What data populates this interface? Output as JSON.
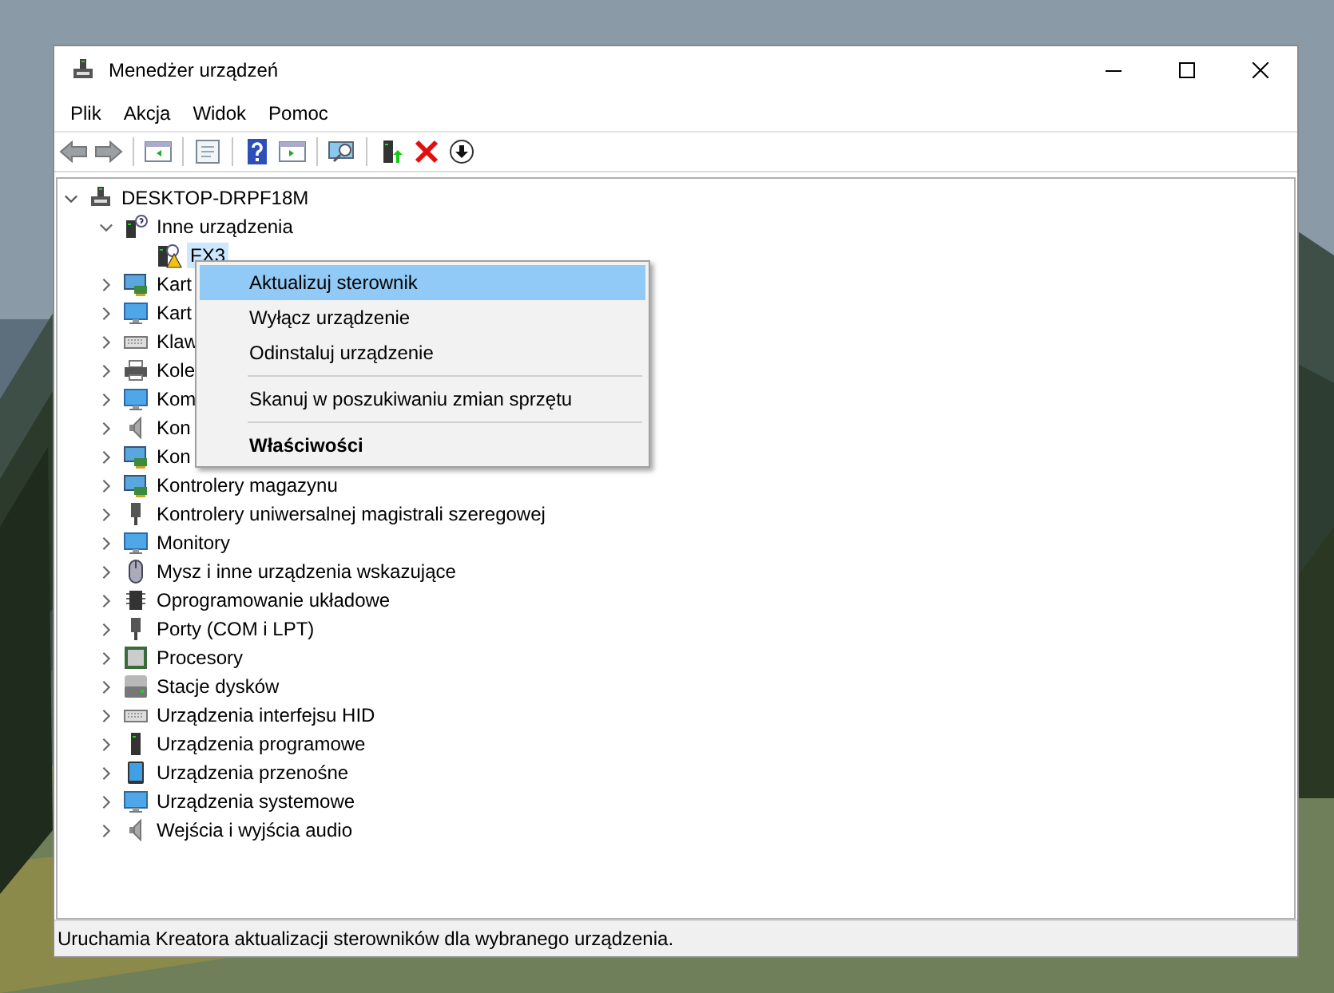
{
  "window": {
    "title": "Menedżer urządzeń"
  },
  "menu_bar": [
    "Plik",
    "Akcja",
    "Widok",
    "Pomoc"
  ],
  "tree": {
    "label": "DESKTOP-DRPF18M",
    "expanded": true,
    "selected": false,
    "children": [
      {
        "label": "Inne urządzenia",
        "expanded": true,
        "selected": false,
        "children": [
          {
            "label": "FX3",
            "selected": true,
            "warning": true
          }
        ]
      },
      {
        "label": "Kart",
        "expanded": false,
        "selected": false
      },
      {
        "label": "Kart",
        "expanded": false,
        "selected": false
      },
      {
        "label": "Klaw",
        "expanded": false,
        "selected": false
      },
      {
        "label": "Kole",
        "expanded": false,
        "selected": false
      },
      {
        "label": "Kom",
        "expanded": false,
        "selected": false
      },
      {
        "label": "Kon",
        "expanded": false,
        "selected": false
      },
      {
        "label": "Kon",
        "expanded": false,
        "selected": false
      },
      {
        "label": "Kontrolery magazynu",
        "expanded": false,
        "selected": false
      },
      {
        "label": "Kontrolery uniwersalnej magistrali szeregowej",
        "expanded": false,
        "selected": false
      },
      {
        "label": "Monitory",
        "expanded": false,
        "selected": false
      },
      {
        "label": "Mysz i inne urządzenia wskazujące",
        "expanded": false,
        "selected": false
      },
      {
        "label": "Oprogramowanie układowe",
        "expanded": false,
        "selected": false
      },
      {
        "label": "Porty (COM i LPT)",
        "expanded": false,
        "selected": false
      },
      {
        "label": "Procesory",
        "expanded": false,
        "selected": false
      },
      {
        "label": "Stacje dysków",
        "expanded": false,
        "selected": false
      },
      {
        "label": "Urządzenia interfejsu HID",
        "expanded": false,
        "selected": false
      },
      {
        "label": "Urządzenia programowe",
        "expanded": false,
        "selected": false
      },
      {
        "label": "Urządzenia przenośne",
        "expanded": false,
        "selected": false
      },
      {
        "label": "Urządzenia systemowe",
        "expanded": false,
        "selected": false
      },
      {
        "label": "Wejścia i wyjścia audio",
        "expanded": false,
        "selected": false
      }
    ]
  },
  "context_menu": [
    {
      "kind": "item",
      "label": "Aktualizuj sterownik",
      "selected": true,
      "default": false
    },
    {
      "kind": "item",
      "label": "Wyłącz urządzenie",
      "selected": false,
      "default": false
    },
    {
      "kind": "item",
      "label": "Odinstaluj urządzenie",
      "selected": false,
      "default": false
    },
    {
      "kind": "separator"
    },
    {
      "kind": "item",
      "label": "Skanuj w poszukiwaniu zmian sprzętu",
      "selected": false,
      "default": false
    },
    {
      "kind": "separator"
    },
    {
      "kind": "item",
      "label": "Właściwości",
      "selected": false,
      "default": true
    }
  ],
  "status_bar": "Uruchamia Kreatora aktualizacji sterowników dla wybranego urządzenia."
}
